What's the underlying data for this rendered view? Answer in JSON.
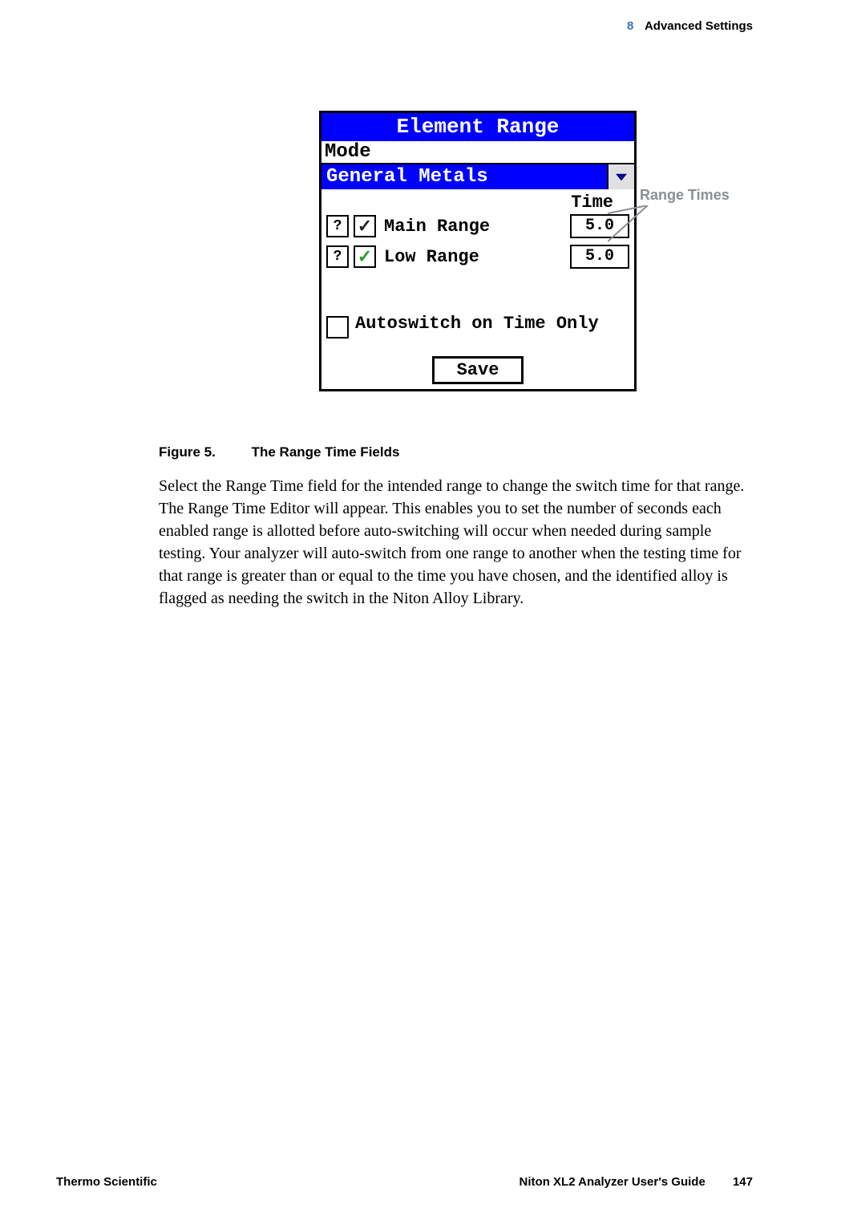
{
  "header": {
    "chapter_number": "8",
    "chapter_title": "Advanced Settings"
  },
  "device": {
    "title": "Element Range",
    "mode_label": "Mode",
    "mode_value": "General Metals",
    "time_header": "Time",
    "ranges": [
      {
        "label": "Main Range",
        "time": "5.0",
        "help": "?",
        "check_style": "dark"
      },
      {
        "label": "Low Range",
        "time": "5.0",
        "help": "?",
        "check_style": "green"
      }
    ],
    "autoswitch_label": "Autoswitch on Time Only",
    "save_label": "Save"
  },
  "callout": {
    "label": "Range Times"
  },
  "figure": {
    "number": "Figure 5.",
    "title": "The Range Time Fields"
  },
  "body": "Select the Range Time field for the intended range to change the switch time for that range. The Range Time Editor will appear. This enables you to set the number of seconds each enabled range is allotted before auto-switching will occur when needed during sample testing. Your analyzer will auto-switch from one range to another when the testing time for that range is greater than or equal to the time you have chosen, and the identified alloy is flagged as needing the switch in the Niton Alloy Library.",
  "footer": {
    "left": "Thermo Scientific",
    "right_title": "Niton XL2 Analyzer User's Guide",
    "page": "147"
  }
}
